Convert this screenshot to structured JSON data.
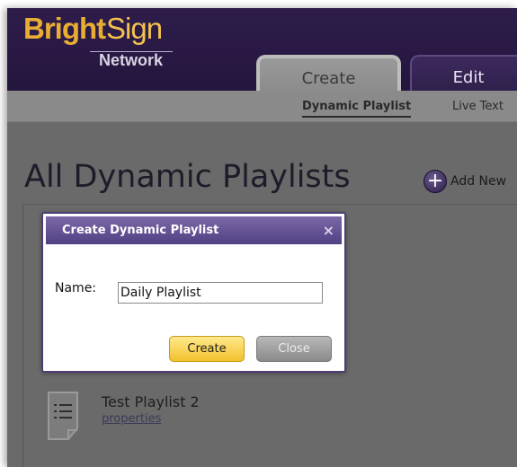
{
  "header": {
    "logo_part1": "Bright",
    "logo_part2": "Sign",
    "logo_sub": "Network"
  },
  "tabs": [
    {
      "label": "Create",
      "active": true
    },
    {
      "label": "Edit",
      "active": false
    }
  ],
  "subnav": {
    "active_label": "Dynamic Playlist",
    "other_label": "Live Text"
  },
  "page": {
    "title": "All Dynamic Playlists",
    "add_new_label": "Add New"
  },
  "playlist_item": {
    "title": "Test Playlist 2",
    "properties_label": "properties"
  },
  "dialog": {
    "title": "Create Dynamic Playlist",
    "close_glyph": "×",
    "name_label": "Name:",
    "name_value": "Daily Playlist",
    "create_label": "Create",
    "close_label": "Close"
  },
  "colors": {
    "header_bg": "#2e1d4b",
    "logo_gold": "#e8ad33",
    "overlay_gray": "#6a6a6a",
    "create_button": "#f2c12e",
    "dialog_bar": "#514083"
  },
  "icons": {
    "add": "plus-circle-icon",
    "document": "document-lines-icon",
    "close": "close-icon"
  }
}
